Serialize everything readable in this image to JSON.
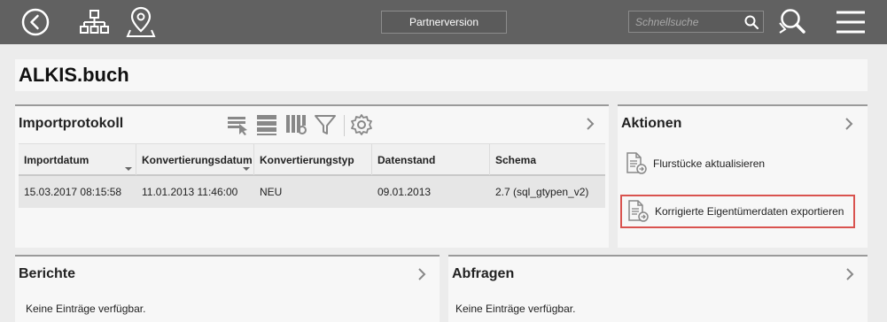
{
  "header": {
    "partner_label": "Partnerversion",
    "search_placeholder": "Schnellsuche"
  },
  "page": {
    "title": "ALKIS.buch"
  },
  "import_panel": {
    "title": "Importprotokoll",
    "columns": [
      "Importdatum",
      "Konvertierungsdatum",
      "Konvertierungstyp",
      "Datenstand",
      "Schema"
    ],
    "rows": [
      [
        "15.03.2017 08:15:58",
        "11.01.2013 11:46:00",
        "NEU",
        "09.01.2013",
        "2.7 (sql_gtypen_v2)"
      ]
    ]
  },
  "actions_panel": {
    "title": "Aktionen",
    "items": [
      {
        "label": "Flurstücke aktualisieren"
      },
      {
        "label": "Korrigierte Eigentümerdaten exportieren"
      }
    ]
  },
  "reports_panel": {
    "title": "Berichte",
    "empty_text": "Keine Einträge verfügbar."
  },
  "queries_panel": {
    "title": "Abfragen",
    "empty_text": "Keine Einträge verfügbar."
  },
  "colors": {
    "topbar": "#616161",
    "highlight": "#d9534f"
  }
}
